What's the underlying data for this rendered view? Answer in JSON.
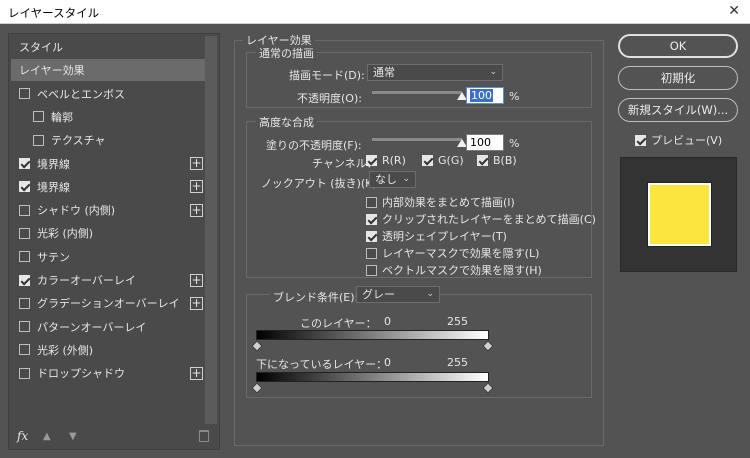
{
  "window": {
    "title": "レイヤースタイル",
    "close_glyph": "✕"
  },
  "styles_list": {
    "items": [
      {
        "label": "スタイル",
        "has_checkbox": false,
        "checked": false,
        "has_plus": false,
        "selected": false,
        "indent": 0
      },
      {
        "label": "レイヤー効果",
        "has_checkbox": false,
        "checked": false,
        "has_plus": false,
        "selected": true,
        "indent": 0
      },
      {
        "label": "ベベルとエンボス",
        "has_checkbox": true,
        "checked": false,
        "has_plus": false,
        "selected": false,
        "indent": 0
      },
      {
        "label": "輪郭",
        "has_checkbox": true,
        "checked": false,
        "has_plus": false,
        "selected": false,
        "indent": 1
      },
      {
        "label": "テクスチャ",
        "has_checkbox": true,
        "checked": false,
        "has_plus": false,
        "selected": false,
        "indent": 1
      },
      {
        "label": "境界線",
        "has_checkbox": true,
        "checked": true,
        "has_plus": true,
        "selected": false,
        "indent": 0
      },
      {
        "label": "境界線",
        "has_checkbox": true,
        "checked": true,
        "has_plus": true,
        "selected": false,
        "indent": 0
      },
      {
        "label": "シャドウ (内側)",
        "has_checkbox": true,
        "checked": false,
        "has_plus": true,
        "selected": false,
        "indent": 0
      },
      {
        "label": "光彩 (内側)",
        "has_checkbox": true,
        "checked": false,
        "has_plus": false,
        "selected": false,
        "indent": 0
      },
      {
        "label": "サテン",
        "has_checkbox": true,
        "checked": false,
        "has_plus": false,
        "selected": false,
        "indent": 0
      },
      {
        "label": "カラーオーバーレイ",
        "has_checkbox": true,
        "checked": true,
        "has_plus": true,
        "selected": false,
        "indent": 0
      },
      {
        "label": "グラデーションオーバーレイ",
        "has_checkbox": true,
        "checked": false,
        "has_plus": true,
        "selected": false,
        "indent": 0
      },
      {
        "label": "パターンオーバーレイ",
        "has_checkbox": true,
        "checked": false,
        "has_plus": false,
        "selected": false,
        "indent": 0
      },
      {
        "label": "光彩 (外側)",
        "has_checkbox": true,
        "checked": false,
        "has_plus": false,
        "selected": false,
        "indent": 0
      },
      {
        "label": "ドロップシャドウ",
        "has_checkbox": true,
        "checked": false,
        "has_plus": true,
        "selected": false,
        "indent": 0
      }
    ],
    "footer": {
      "fx_label": "fx"
    }
  },
  "layer_effects": {
    "title": "レイヤー効果",
    "normal": {
      "title": "通常の描画",
      "blend_mode_label": "描画モード(D):",
      "blend_mode_value": "通常",
      "opacity_label": "不透明度(O):",
      "opacity_value": "100",
      "opacity_fraction": 1.0,
      "percent": "%"
    },
    "advanced": {
      "title": "高度な合成",
      "fill_opacity_label": "塗りの不透明度(F):",
      "fill_opacity_value": "100",
      "fill_opacity_fraction": 1.0,
      "percent": "%",
      "channels_label": "チャンネル：",
      "channels": [
        {
          "label": "R(R)",
          "checked": true
        },
        {
          "label": "G(G)",
          "checked": true
        },
        {
          "label": "B(B)",
          "checked": true
        }
      ],
      "knockout_label": "ノックアウト (抜き)(K):",
      "knockout_value": "なし",
      "options": [
        {
          "label": "内部効果をまとめて描画(I)",
          "checked": false
        },
        {
          "label": "クリップされたレイヤーをまとめて描画(C)",
          "checked": true
        },
        {
          "label": "透明シェイプレイヤー(T)",
          "checked": true
        },
        {
          "label": "レイヤーマスクで効果を隠す(L)",
          "checked": false
        },
        {
          "label": "ベクトルマスクで効果を隠す(H)",
          "checked": false
        }
      ]
    },
    "blend_if": {
      "label": "ブレンド条件(E):",
      "value": "グレー",
      "this_layer_label": "このレイヤー：",
      "this_layer_min": "0",
      "this_layer_max": "255",
      "underlying_label": "下になっているレイヤー：",
      "underlying_min": "0",
      "underlying_max": "255"
    }
  },
  "buttons": {
    "ok": "OK",
    "reset": "初期化",
    "new_style": "新規スタイル(W)...",
    "preview_label": "プレビュー(V)",
    "preview_checked": true
  },
  "preview": {
    "swatch_color": "#fde540"
  }
}
